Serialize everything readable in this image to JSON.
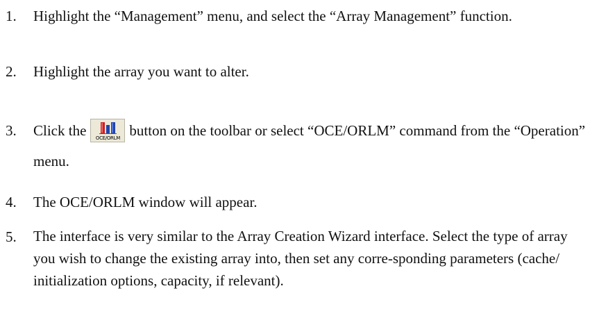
{
  "steps": [
    {
      "number": "1.",
      "text": "Highlight the “Management” menu, and select the “Array Management” function."
    },
    {
      "number": "2.",
      "text": "Highlight the array you want to alter."
    },
    {
      "number": "3.",
      "text_before": "Click the",
      "text_after": "button on the toolbar or select “OCE/ORLM” command from the “Operation” menu.",
      "toolbar_button": {
        "caption": "OCE/ORLM",
        "icon": "oce-orlm-icon"
      }
    },
    {
      "number": "4.",
      "text": "The OCE/ORLM window will appear."
    },
    {
      "number": "5.",
      "text": "The interface is very similar to the Array Creation Wizard interface.  Select the type of array you wish to change the existing array into, then set any corre-sponding parameters (cache/ initialization options, capacity, if relevant)."
    }
  ],
  "colors": {
    "text": "#111111",
    "toolbar_face": "#ece9d8",
    "icon_red": "#cc2222",
    "icon_blue": "#2244aa"
  }
}
